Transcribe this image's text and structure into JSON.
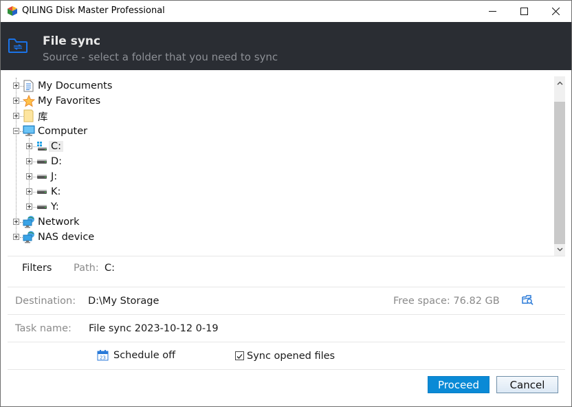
{
  "window": {
    "title": "QILING Disk Master Professional",
    "controls": {
      "minimize": "minimize",
      "maximize": "maximize",
      "close": "close"
    }
  },
  "header": {
    "title": "File sync",
    "subtitle": "Source - select a folder that you need to sync",
    "icon": "folder-sync-icon"
  },
  "tree": {
    "items": [
      {
        "label": "My Documents",
        "icon": "document-icon",
        "expanded": false,
        "level": 0
      },
      {
        "label": "My Favorites",
        "icon": "star-icon",
        "expanded": false,
        "level": 0
      },
      {
        "label": "库",
        "icon": "library-folder-icon",
        "expanded": false,
        "level": 0
      },
      {
        "label": "Computer",
        "icon": "computer-icon",
        "expanded": true,
        "level": 0
      },
      {
        "label": "C:",
        "icon": "system-drive-icon",
        "expanded": false,
        "level": 1,
        "selected": true
      },
      {
        "label": "D:",
        "icon": "drive-icon",
        "expanded": false,
        "level": 1
      },
      {
        "label": "J:",
        "icon": "drive-icon",
        "expanded": false,
        "level": 1
      },
      {
        "label": "K:",
        "icon": "drive-icon",
        "expanded": false,
        "level": 1
      },
      {
        "label": "Y:",
        "icon": "drive-icon",
        "expanded": false,
        "level": 1
      },
      {
        "label": "Network",
        "icon": "network-icon",
        "expanded": false,
        "level": 0
      },
      {
        "label": "NAS device",
        "icon": "nas-icon",
        "expanded": false,
        "level": 0
      }
    ]
  },
  "filters": {
    "button_label": "Filters",
    "path_label": "Path:",
    "path_value": "C:"
  },
  "destination": {
    "label": "Destination:",
    "value": "D:\\My Storage",
    "free_space": "Free space: 76.82 GB",
    "browse_icon": "browse-folder-icon"
  },
  "task": {
    "label": "Task name:",
    "value": "File sync 2023-10-12 0-19"
  },
  "options": {
    "schedule_label": "Schedule off",
    "sync_opened_label": "Sync opened files",
    "sync_opened_checked": true
  },
  "buttons": {
    "proceed": "Proceed",
    "cancel": "Cancel"
  },
  "colors": {
    "accent": "#0a8ad6",
    "header_bg": "#2a2d33",
    "icon_blue": "#1a73e8"
  }
}
